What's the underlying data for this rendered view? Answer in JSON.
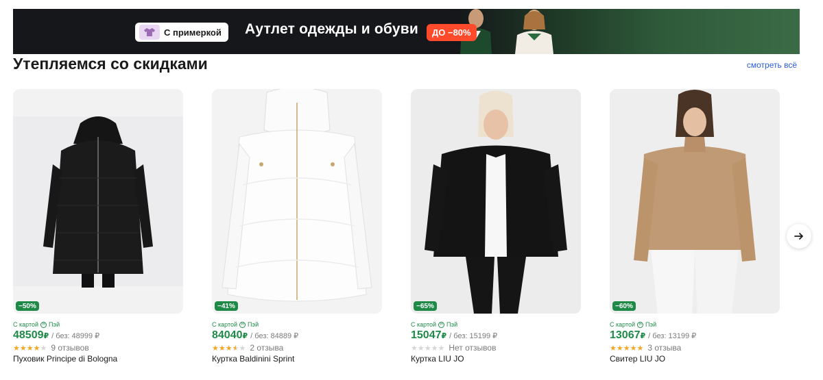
{
  "banner": {
    "try_on_label": "С примеркой",
    "title": "Аутлет одежды и обуви",
    "discount": "ДО −80%"
  },
  "section": {
    "title": "Утепляемся со скидками",
    "see_all": "смотреть всё"
  },
  "products": [
    {
      "discount": "−50%",
      "with_card": "С картой",
      "pay": "Пэй",
      "price": "48509",
      "currency": "₽",
      "without": "/ без: 48999 ₽",
      "rating": 4,
      "reviews": "9 отзывов",
      "name": "Пуховик Principe di Bologna"
    },
    {
      "discount": "−41%",
      "with_card": "С картой",
      "pay": "Пэй",
      "price": "84040",
      "currency": "₽",
      "without": "/ без: 84889 ₽",
      "rating": 3.5,
      "reviews": "2 отзыва",
      "name": "Куртка Baldinini Sprint"
    },
    {
      "discount": "−65%",
      "with_card": "С картой",
      "pay": "Пэй",
      "price": "15047",
      "currency": "₽",
      "without": "/ без: 15199 ₽",
      "rating": 0,
      "reviews": "Нет отзывов",
      "name": "Куртка LIU JO"
    },
    {
      "discount": "−60%",
      "with_card": "С картой",
      "pay": "Пэй",
      "price": "13067",
      "currency": "₽",
      "without": "/ без: 13199 ₽",
      "rating": 5,
      "reviews": "3 отзыва",
      "name": "Свитер LIU JO"
    }
  ],
  "colors": {
    "discount_green": "#1f8a48",
    "star_orange": "#f5a623",
    "star_gray": "#d6d6d6",
    "banner_orange": "#ff4b2b",
    "link_blue": "#2a5bd7"
  },
  "icons": {
    "next": "arrow-right-icon",
    "pay": "pay-logo-icon",
    "try_on": "shirt-icon"
  }
}
